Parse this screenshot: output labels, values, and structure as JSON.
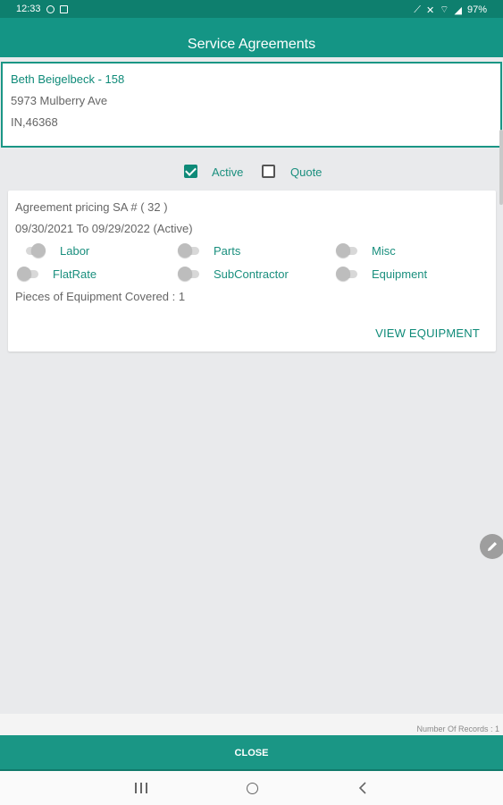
{
  "status_bar": {
    "time": "12:33",
    "battery": "97%",
    "left_icons": [
      "dnd-icon",
      "sim-icon"
    ],
    "right_icons": [
      "no-data-icon",
      "mute-icon",
      "wifi-icon",
      "signal-icon"
    ]
  },
  "app_bar": {
    "title": "Service Agreements"
  },
  "customer": {
    "name": "Beth Beigelbeck - 158",
    "street": "5973 Mulberry Ave",
    "state_zip": "IN,46368"
  },
  "filters": {
    "active": {
      "label": "Active",
      "checked": true
    },
    "quote": {
      "label": "Quote",
      "checked": false
    }
  },
  "agreement": {
    "title": "Agreement pricing SA # ( 32 )",
    "dates": "09/30/2021 To 09/29/2022 (Active)",
    "toggles": [
      {
        "label": "Labor",
        "on": true
      },
      {
        "label": "Parts",
        "on": false
      },
      {
        "label": "Misc",
        "on": false
      },
      {
        "label": "FlatRate",
        "on": false
      },
      {
        "label": "SubContractor",
        "on": false
      },
      {
        "label": "Equipment",
        "on": false
      }
    ],
    "equipment_covered": "Pieces of Equipment Covered : 1",
    "view_button": "VIEW EQUIPMENT"
  },
  "footer": {
    "records": "Number Of Records : 1",
    "close_label": "CLOSE"
  },
  "colors": {
    "primary": "#149585",
    "primary_dark": "#0e7f6e",
    "accent_text": "#1a8f7e",
    "background": "#e9eaec"
  }
}
